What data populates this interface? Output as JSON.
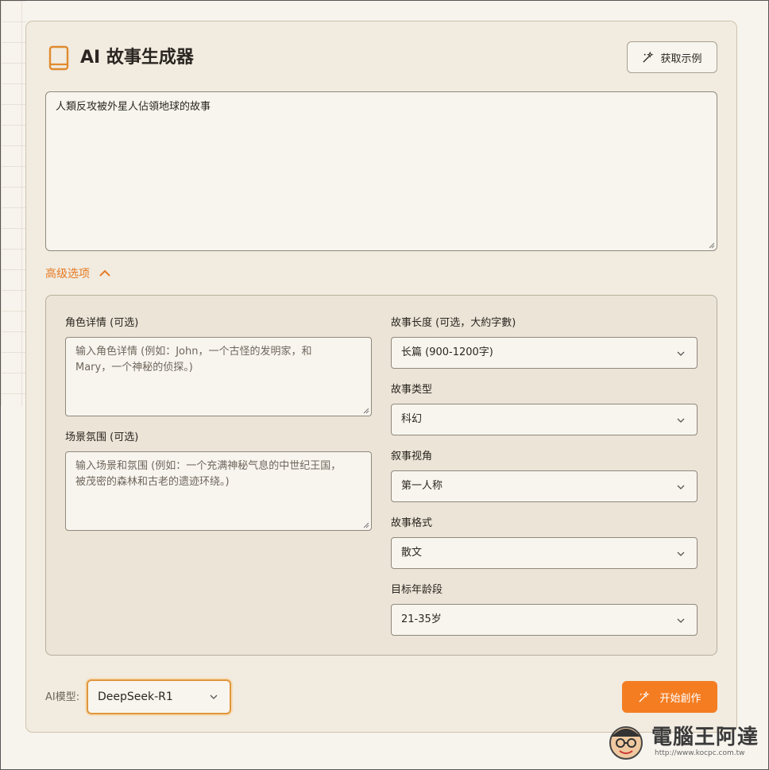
{
  "app": {
    "title": "AI 故事生成器",
    "example_button": "获取示例"
  },
  "story_prompt": {
    "value": "人類反攻被外星人佔領地球的故事"
  },
  "advanced": {
    "toggle_label": "高级选项",
    "character": {
      "label": "角色详情 (可选)",
      "placeholder_line1": "输入角色详情 (例如：John，一个古怪的发明家，和",
      "placeholder_line2": "Mary，一个神秘的侦探。)"
    },
    "scene": {
      "label": "场景氛围 (可选)",
      "placeholder_line1": "输入场景和氛围 (例如：一个充满神秘气息的中世纪王国，",
      "placeholder_line2": "被茂密的森林和古老的遗迹环绕。)"
    },
    "length": {
      "label": "故事长度 (可选，大約字數)",
      "value": "长篇 (900-1200字)"
    },
    "genre": {
      "label": "故事类型",
      "value": "科幻"
    },
    "perspective": {
      "label": "叙事视角",
      "value": "第一人称"
    },
    "format": {
      "label": "故事格式",
      "value": "散文"
    },
    "age": {
      "label": "目标年龄段",
      "value": "21-35岁"
    }
  },
  "footer": {
    "model_label": "AI模型:",
    "model_value": "DeepSeek-R1",
    "start_button": "开始創作"
  },
  "watermark": {
    "brand": "電腦王阿達",
    "url": "http://www.kocpc.com.tw"
  },
  "colors": {
    "accent": "#f47d22",
    "card_bg": "#f1ebe0",
    "page_bg": "#f7f4ed"
  }
}
